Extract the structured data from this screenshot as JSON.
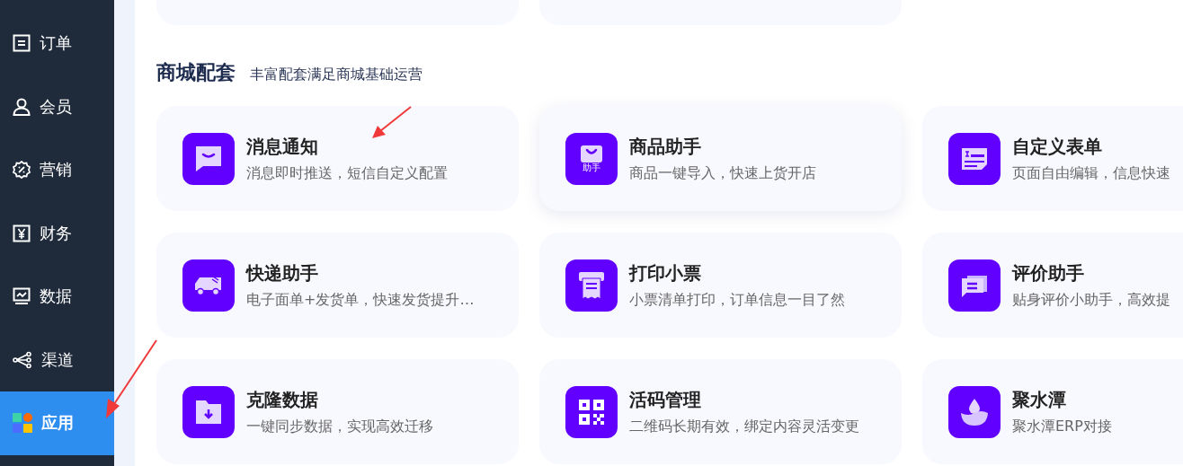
{
  "sidebar": {
    "items": [
      {
        "label": "订单",
        "selected": false
      },
      {
        "label": "会员",
        "selected": false
      },
      {
        "label": "营销",
        "selected": false
      },
      {
        "label": "财务",
        "selected": false
      },
      {
        "label": "数据",
        "selected": false
      },
      {
        "label": "渠道",
        "selected": false
      },
      {
        "label": "应用",
        "selected": true
      }
    ]
  },
  "section": {
    "title": "商城配套",
    "subtitle": "丰富配套满足商城基础运营"
  },
  "cards": [
    {
      "title": "消息通知",
      "description": "消息即时推送，短信自定义配置",
      "hovered": false
    },
    {
      "title": "商品助手",
      "description": "商品一键导入，快速上货开店",
      "hovered": true,
      "icon_label": "助手"
    },
    {
      "title": "自定义表单",
      "description": "页面自由编辑，信息快速",
      "hovered": false
    },
    {
      "title": "快递助手",
      "description": "电子面单+发货单，快速发货提升…",
      "hovered": false
    },
    {
      "title": "打印小票",
      "description": "小票清单打印，订单信息一目了然",
      "hovered": false
    },
    {
      "title": "评价助手",
      "description": "贴身评价小助手，高效提",
      "hovered": false
    },
    {
      "title": "克隆数据",
      "description": "一键同步数据，实现高效迁移",
      "hovered": false
    },
    {
      "title": "活码管理",
      "description": "二维码长期有效，绑定内容灵活变更",
      "hovered": false
    },
    {
      "title": "聚水潭",
      "description": "聚水潭ERP对接",
      "hovered": false
    }
  ]
}
